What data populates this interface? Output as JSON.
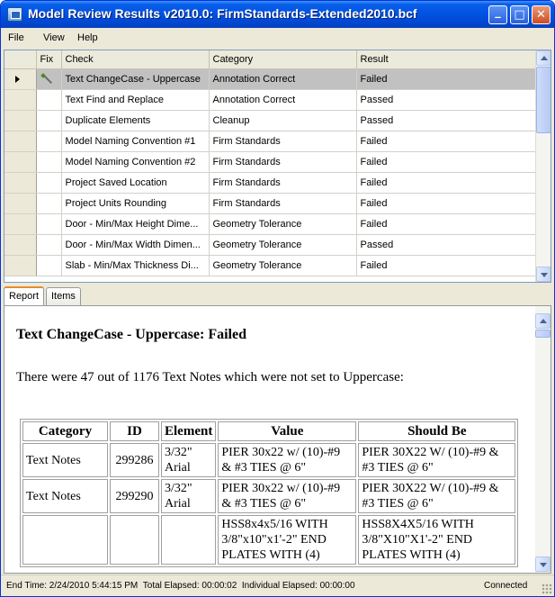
{
  "window": {
    "title": "Model Review Results v2010.0: FirmStandards-Extended2010.bcf",
    "buttons": {
      "minimize": "_",
      "maximize": "□",
      "close": "✕"
    }
  },
  "menu": {
    "items": [
      "File",
      "View",
      "Help"
    ]
  },
  "checks_grid": {
    "columns": {
      "fix": "Fix",
      "check": "Check",
      "category": "Category",
      "result": "Result"
    },
    "rows": [
      {
        "check": "Text ChangeCase - Uppercase",
        "category": "Annotation Correct",
        "result": "Failed",
        "selected": true,
        "fixable": true
      },
      {
        "check": "Text Find and Replace",
        "category": "Annotation Correct",
        "result": "Passed"
      },
      {
        "check": "Duplicate Elements",
        "category": "Cleanup",
        "result": "Passed"
      },
      {
        "check": "Model Naming Convention #1",
        "category": "Firm Standards",
        "result": "Failed"
      },
      {
        "check": "Model Naming Convention #2",
        "category": "Firm Standards",
        "result": "Failed"
      },
      {
        "check": "Project Saved Location",
        "category": "Firm Standards",
        "result": "Failed"
      },
      {
        "check": "Project Units Rounding",
        "category": "Firm Standards",
        "result": "Failed"
      },
      {
        "check": "Door - Min/Max Height Dime...",
        "category": "Geometry Tolerance",
        "result": "Failed"
      },
      {
        "check": "Door - Min/Max Width Dimen...",
        "category": "Geometry Tolerance",
        "result": "Passed"
      },
      {
        "check": "Slab - Min/Max Thickness Di...",
        "category": "Geometry Tolerance",
        "result": "Failed"
      }
    ]
  },
  "tabs": [
    {
      "label": "Report",
      "active": true
    },
    {
      "label": "Items",
      "active": false
    }
  ],
  "report": {
    "title": "Text ChangeCase - Uppercase: Failed",
    "summary": "There were 47 out of 1176 Text Notes which were not set to Uppercase:",
    "columns": {
      "category": "Category",
      "id": "ID",
      "element": "Element",
      "value": "Value",
      "should_be": "Should Be"
    },
    "rows": [
      {
        "category": "Text Notes",
        "id": "299286",
        "element": "3/32\" Arial",
        "value": "PIER 30x22 w/ (10)-#9 & #3 TIES @ 6\"",
        "should_be": "PIER 30X22 W/ (10)-#9 & #3 TIES @ 6\""
      },
      {
        "category": "Text Notes",
        "id": "299290",
        "element": "3/32\" Arial",
        "value": "PIER 30x22 w/ (10)-#9 & #3 TIES @ 6\"",
        "should_be": "PIER 30X22 W/ (10)-#9 & #3 TIES @ 6\""
      },
      {
        "category": "",
        "id": "",
        "element": "",
        "value": "HSS8x4x5/16 WITH 3/8\"x10\"x1'-2\" END PLATES WITH (4)",
        "should_be": "HSS8X4X5/16 WITH 3/8\"X10\"X1'-2\" END PLATES WITH (4)"
      }
    ]
  },
  "status": {
    "end_time": "End Time: 2/24/2010 5:44:15 PM",
    "total_elapsed": "Total Elapsed: 00:00:02",
    "individual_elapsed": "Individual Elapsed: 00:00:00",
    "connection": "Connected"
  },
  "colors": {
    "titlebar": "#0054e3",
    "selected_row": "#c1c1c1",
    "active_tab_accent": "#e68b2c",
    "chrome": "#ece9d8"
  },
  "icons": [
    "app-icon",
    "wand-icon",
    "row-selector-arrow-icon",
    "chevron-up-icon",
    "chevron-down-icon",
    "resize-grip-icon"
  ]
}
